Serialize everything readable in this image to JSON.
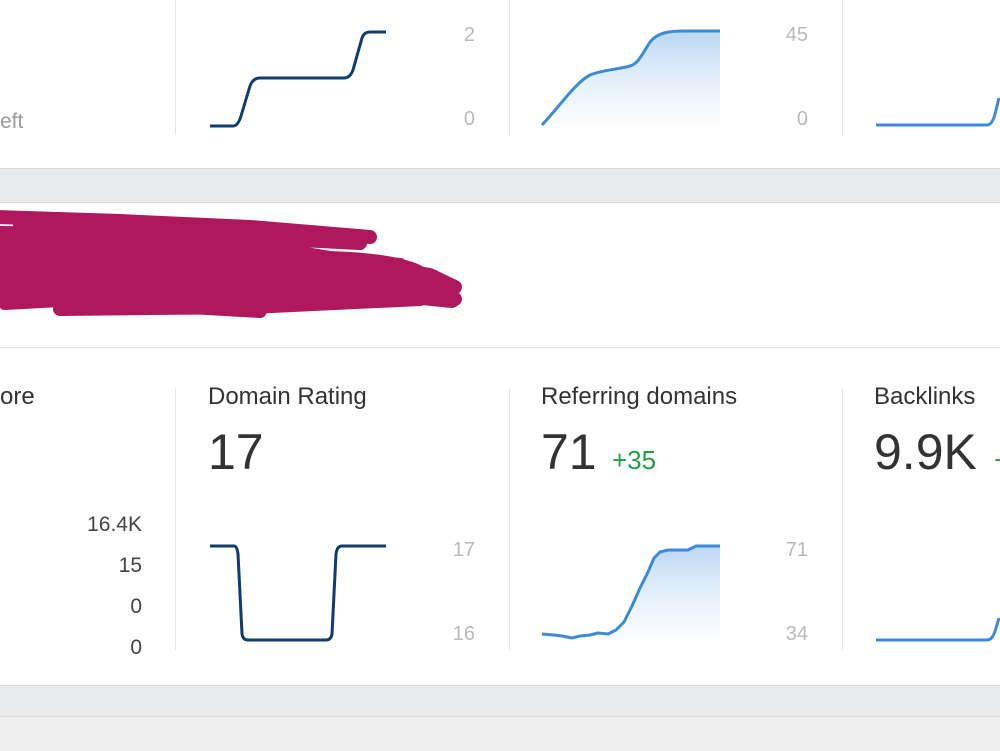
{
  "top_card": {
    "left_partial_label": "eft",
    "panels": [
      {
        "name": "panel-1",
        "axis_max": "2",
        "axis_min": "0",
        "color": "#123c6e",
        "style": "step",
        "fill": false
      },
      {
        "name": "panel-2",
        "axis_max": "45",
        "axis_min": "0",
        "color": "#3d8bd8",
        "style": "curve",
        "fill": true
      },
      {
        "name": "panel-3",
        "color": "#3d8bd8",
        "style": "curve",
        "fill": false
      }
    ]
  },
  "header": {
    "redacted": true,
    "redaction_color": "#b0185e"
  },
  "bottom_card": {
    "left_partial": {
      "label": "ore",
      "axis": [
        "16.4K",
        "15",
        "0",
        "0"
      ]
    },
    "metrics": [
      {
        "label": "Domain Rating",
        "value": "17",
        "delta": "",
        "axis_max": "17",
        "axis_min": "16",
        "color": "#123c6e"
      },
      {
        "label": "Referring domains",
        "value": "71",
        "delta": "+35",
        "axis_max": "71",
        "axis_min": "34",
        "color": "#3d8bd8"
      },
      {
        "label": "Backlinks",
        "value": "9.9K",
        "delta": "+",
        "color": "#3d8bd8"
      }
    ]
  },
  "colors": {
    "positive_delta": "#21a04a",
    "page_background": "#e9eaeb",
    "dark_line": "#123c6e",
    "light_line": "#3d8bd8"
  }
}
